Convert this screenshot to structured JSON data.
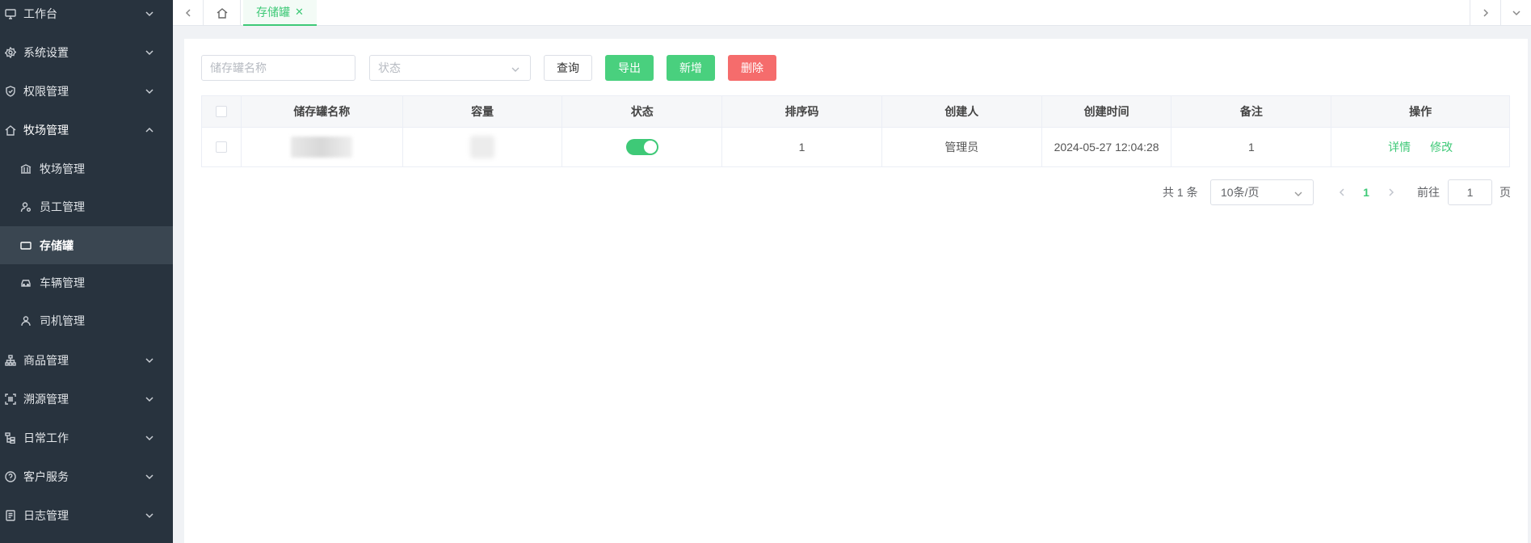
{
  "sidebar": {
    "items": [
      {
        "label": "工作台",
        "icon": "monitor-icon"
      },
      {
        "label": "系统设置",
        "icon": "gear-icon"
      },
      {
        "label": "权限管理",
        "icon": "shield-icon"
      },
      {
        "label": "牧场管理",
        "icon": "home-icon"
      },
      {
        "label": "商品管理",
        "icon": "sitemap-icon"
      },
      {
        "label": "溯源管理",
        "icon": "scan-icon"
      },
      {
        "label": "日常工作",
        "icon": "tree-icon"
      },
      {
        "label": "客户服务",
        "icon": "help-icon"
      },
      {
        "label": "日志管理",
        "icon": "document-icon"
      }
    ],
    "subitems": [
      {
        "label": "牧场管理",
        "icon": "bank-icon"
      },
      {
        "label": "员工管理",
        "icon": "user-settings-icon"
      },
      {
        "label": "存储罐",
        "icon": "tank-icon"
      },
      {
        "label": "车辆管理",
        "icon": "car-icon"
      },
      {
        "label": "司机管理",
        "icon": "user-icon"
      }
    ]
  },
  "tabs": {
    "active_label": "存储罐",
    "close_symbol": "✕"
  },
  "filters": {
    "name_placeholder": "储存罐名称",
    "status_placeholder": "状态",
    "query_label": "查询",
    "export_label": "导出",
    "add_label": "新增",
    "delete_label": "删除"
  },
  "table": {
    "headers": [
      "储存罐名称",
      "容量",
      "状态",
      "排序码",
      "创建人",
      "创建时间",
      "备注",
      "操作"
    ],
    "rows": [
      {
        "status_on": true,
        "sort_code": "1",
        "creator": "管理员",
        "created_at": "2024-05-27 12:04:28",
        "remark": "1",
        "actions": [
          "详情",
          "修改"
        ]
      }
    ]
  },
  "pagination": {
    "total": "共 1 条",
    "page_size": "10条/页",
    "current_page": "1",
    "goto_label": "前往",
    "goto_value": "1",
    "page_label": "页"
  },
  "colors": {
    "sidebar_bg": "#28333e",
    "accent_green": "#3ec977",
    "danger_red": "#f56c6c"
  }
}
